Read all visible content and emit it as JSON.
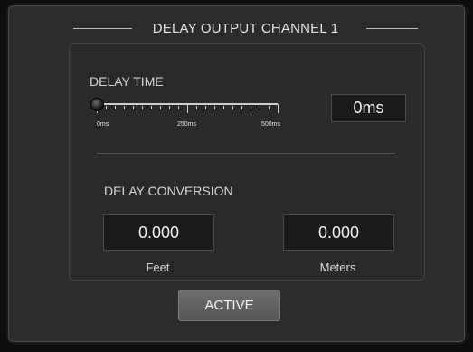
{
  "window": {
    "title": "DELAY OUTPUT CHANNEL 1"
  },
  "delay_time": {
    "label": "DELAY TIME",
    "min_label": "0ms",
    "mid_label": "250ms",
    "max_label": "500ms",
    "value_fraction": 0,
    "display": "0ms"
  },
  "delay_conversion": {
    "label": "DELAY CONVERSION",
    "feet_value": "0.000",
    "feet_label": "Feet",
    "meters_value": "0.000",
    "meters_label": "Meters"
  },
  "active_button": {
    "label": "ACTIVE"
  },
  "colors": {
    "background": "#2c2c2c",
    "panel": "#2a2a2a",
    "value_box": "#1a1a1a",
    "text": "#e2e2e2",
    "button": "#616161"
  }
}
